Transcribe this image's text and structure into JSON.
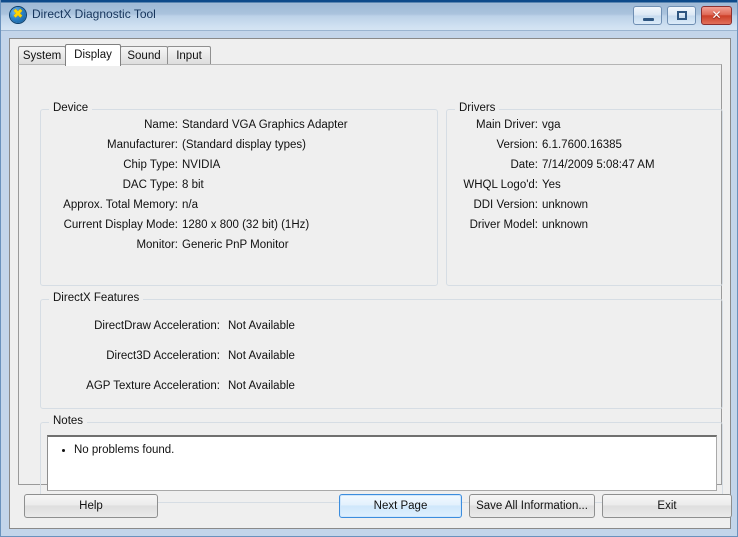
{
  "window": {
    "title": "DirectX Diagnostic Tool",
    "icon": "directx-logo-icon",
    "controls": {
      "minimize": "minimize-icon",
      "maximize": "maximize-icon",
      "close_glyph": "✕"
    },
    "colors": {
      "titlebar_accent": "#0d4a8a",
      "frame": "#c3d5ea",
      "dialog_face": "#efefef",
      "focus_border": "#3c8dde",
      "close_button": "#cc3f28"
    }
  },
  "tabs": [
    {
      "label": "System",
      "active": false
    },
    {
      "label": "Display",
      "active": true
    },
    {
      "label": "Sound",
      "active": false
    },
    {
      "label": "Input",
      "active": false
    }
  ],
  "device": {
    "title": "Device",
    "rows": [
      {
        "label": "Name:",
        "value": "Standard VGA Graphics Adapter"
      },
      {
        "label": "Manufacturer:",
        "value": "(Standard display types)"
      },
      {
        "label": "Chip Type:",
        "value": "NVIDIA"
      },
      {
        "label": "DAC Type:",
        "value": "8 bit"
      },
      {
        "label": "Approx. Total Memory:",
        "value": "n/a"
      },
      {
        "label": "Current Display Mode:",
        "value": "1280 x 800 (32 bit) (1Hz)"
      },
      {
        "label": "Monitor:",
        "value": "Generic PnP Monitor"
      }
    ]
  },
  "drivers": {
    "title": "Drivers",
    "rows": [
      {
        "label": "Main Driver:",
        "value": "vga"
      },
      {
        "label": "Version:",
        "value": "6.1.7600.16385"
      },
      {
        "label": "Date:",
        "value": "7/14/2009 5:08:47 AM"
      },
      {
        "label": "WHQL Logo'd:",
        "value": "Yes"
      },
      {
        "label": "DDI Version:",
        "value": "unknown"
      },
      {
        "label": "Driver Model:",
        "value": "unknown"
      }
    ]
  },
  "features": {
    "title": "DirectX Features",
    "rows": [
      {
        "label": "DirectDraw Acceleration:",
        "value": "Not Available"
      },
      {
        "label": "Direct3D Acceleration:",
        "value": "Not Available"
      },
      {
        "label": "AGP Texture Acceleration:",
        "value": "Not Available"
      }
    ]
  },
  "notes": {
    "title": "Notes",
    "items": [
      "No problems found."
    ]
  },
  "buttons": {
    "help": "Help",
    "next_page": "Next Page",
    "save_all": "Save All Information...",
    "exit": "Exit"
  }
}
